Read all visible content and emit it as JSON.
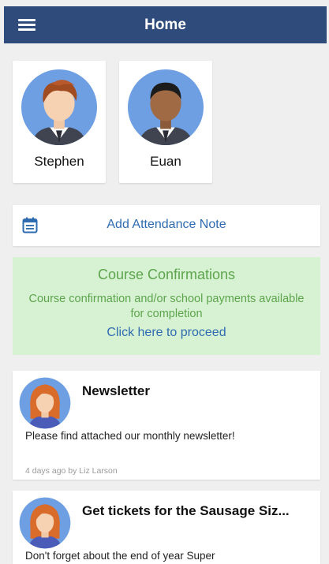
{
  "header": {
    "title": "Home",
    "menu_icon": "hamburger-menu-icon"
  },
  "children": [
    {
      "name": "Stephen",
      "avatar": "boy-avatar-brown-hair"
    },
    {
      "name": "Euan",
      "avatar": "boy-avatar-black-hair"
    }
  ],
  "attendance": {
    "label": "Add Attendance Note",
    "icon": "calendar-icon"
  },
  "course": {
    "title": "Course Confirmations",
    "text": "Course confirmation and/or school payments available for completion",
    "link": "Click here to proceed"
  },
  "posts": [
    {
      "title": "Newsletter",
      "body": "Please find attached our monthly newsletter!",
      "meta": "4 days ago by Liz Larson",
      "avatar": "woman-avatar-orange-hair"
    },
    {
      "title": "Get tickets for the Sausage Siz...",
      "body": "Don't forget about the end of year Super",
      "meta": "",
      "avatar": "woman-avatar-orange-hair"
    }
  ],
  "colors": {
    "header": "#2f4b7c",
    "link": "#2e6bb0",
    "success_bg": "#d7f2d3",
    "success_text": "#5da44c",
    "avatar_bg": "#6f9fe3"
  }
}
